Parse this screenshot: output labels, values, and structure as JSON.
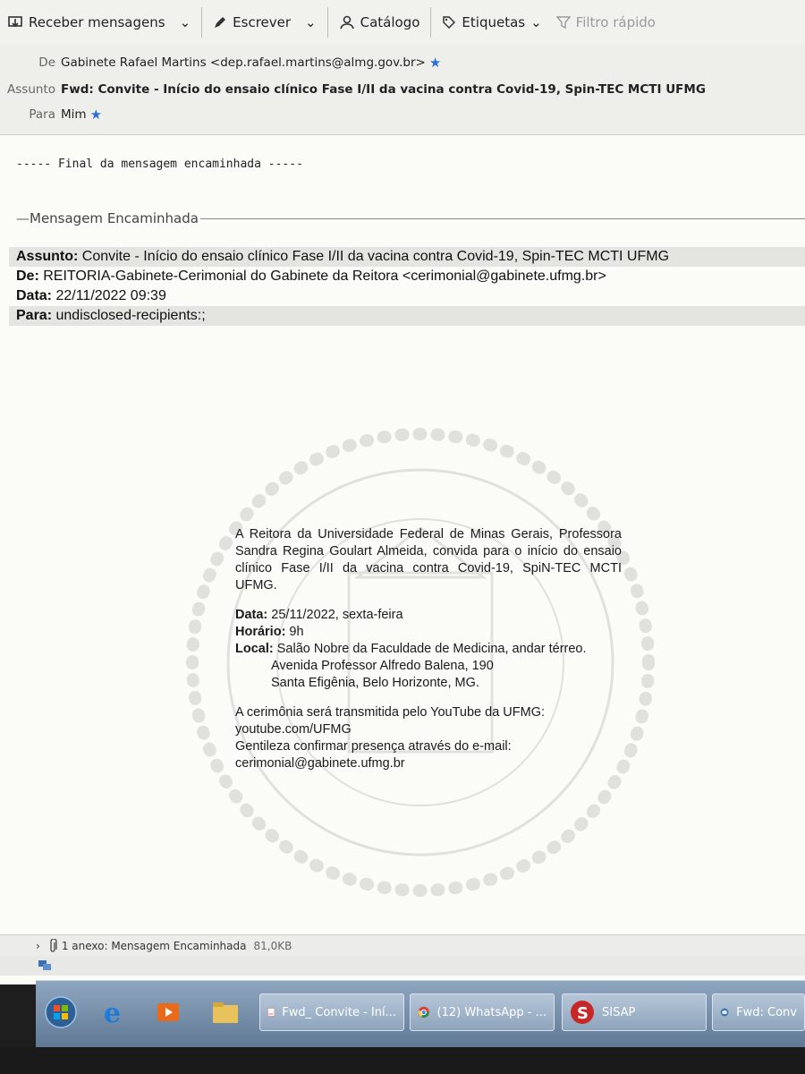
{
  "toolbar": {
    "get_messages": "Receber mensagens",
    "write": "Escrever",
    "catalog": "Catálogo",
    "tags": "Etiquetas",
    "quick_filter": "Filtro rápido"
  },
  "header": {
    "from_label": "De",
    "from_value": "Gabinete Rafael Martins <dep.rafael.martins@almg.gov.br>",
    "subject_label": "Assunto",
    "subject_value": "Fwd: Convite - Início do ensaio clínico Fase I/II da vacina contra Covid-19, Spin-TEC MCTI UFMG",
    "to_label": "Para",
    "to_value": "Mim"
  },
  "body": {
    "end_forward": "----- Final da mensagem encaminhada -----",
    "forwarded_title": "Mensagem Encaminhada",
    "forwarded": {
      "subject_label": "Assunto:",
      "subject_value": " Convite - Início do ensaio clínico Fase I/II da vacina contra Covid-19, Spin-TEC MCTI UFMG",
      "from_label": "De:",
      "from_value": " REITORIA-Gabinete-Cerimonial do Gabinete da Reitora <cerimonial@gabinete.ufmg.br>",
      "date_label": "Data:",
      "date_value": " 22/11/2022 09:39",
      "to_label": "Para:",
      "to_value": " undisclosed-recipients:;"
    },
    "invite": {
      "intro": "A Reitora da Universidade Federal de Minas Gerais, Professora Sandra Regina Goulart Almeida, convida para o início do ensaio clínico Fase I/II da vacina contra Covid-19, SpiN-TEC MCTI UFMG.",
      "date_label": "Data:",
      "date_value": " 25/11/2022, sexta-feira",
      "time_label": "Horário:",
      "time_value": " 9h",
      "place_label": "Local:",
      "place_line1": " Salão Nobre da Faculdade de Medicina, andar térreo.",
      "place_line2": "Avenida Professor Alfredo Balena, 190",
      "place_line3": "Santa Efigênia, Belo Horizonte, MG.",
      "stream_line1": "A cerimônia será transmitida pelo YouTube da UFMG:",
      "stream_line2": "youtube.com/UFMG",
      "confirm_line1": "Gentileza confirmar presença através do e-mail:",
      "confirm_line2": "cerimonial@gabinete.ufmg.br"
    }
  },
  "attachment": {
    "label": "1 anexo: Mensagem Encaminhada",
    "size": "81,0KB"
  },
  "taskbar": {
    "tasks": [
      "Fwd_ Convite - Iní...",
      "(12) WhatsApp - ...",
      "SISAP",
      "Fwd: Conv"
    ]
  },
  "colors": {
    "star": "#2b6fd8",
    "taskbar": "#6f86a3",
    "background": "#fbfbf8"
  }
}
